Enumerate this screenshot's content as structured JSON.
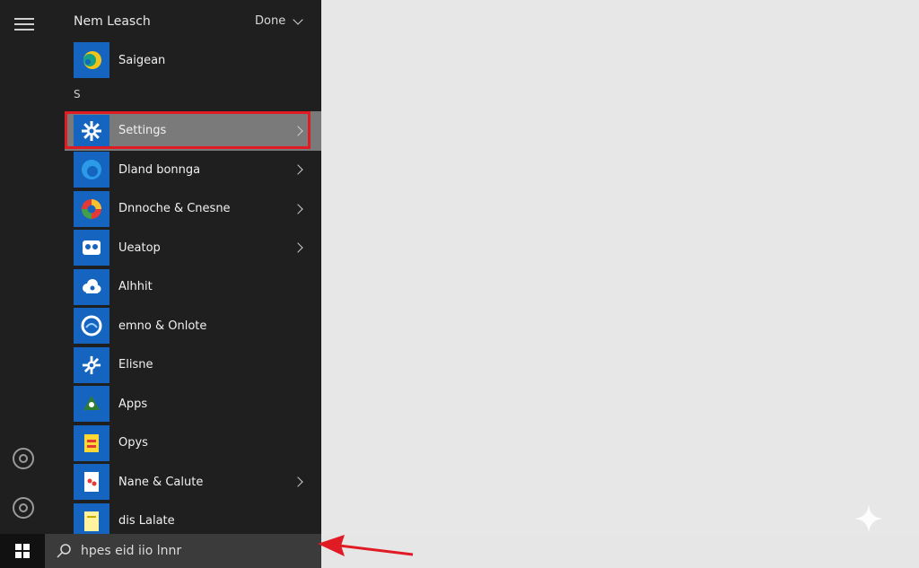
{
  "start_menu": {
    "header_title": "Nem Leasch",
    "header_sort": "Done",
    "pinned": {
      "label": "Saigean"
    },
    "section_letter": "S",
    "items": [
      {
        "label": "Settings",
        "has_arrow": true,
        "selected": true
      },
      {
        "label": "Dland bonnga",
        "has_arrow": true
      },
      {
        "label": "Dnnoche & Cnesne",
        "has_arrow": true
      },
      {
        "label": "Ueatop",
        "has_arrow": true
      },
      {
        "label": "Alhhit",
        "has_arrow": false
      },
      {
        "label": "emno & Onlote",
        "has_arrow": false
      },
      {
        "label": "Elisne",
        "has_arrow": false
      },
      {
        "label": "Apps",
        "has_arrow": false
      },
      {
        "label": "Opys",
        "has_arrow": false
      },
      {
        "label": "Nane & Calute",
        "has_arrow": true
      },
      {
        "label": "dis Lalate",
        "has_arrow": false
      }
    ]
  },
  "taskbar": {
    "search_placeholder": "hpes eid iio lnnr"
  },
  "colors": {
    "highlight": "#e01b24",
    "callout_arrow": "#e01b24",
    "tile_blue": "#1565c0"
  }
}
